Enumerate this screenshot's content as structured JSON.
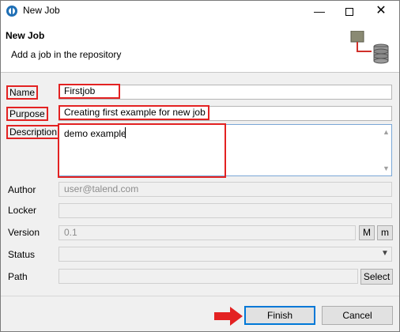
{
  "window": {
    "title": "New Job"
  },
  "header": {
    "title": "New Job",
    "subtitle": "Add a job in the repository"
  },
  "form": {
    "name": {
      "label": "Name",
      "value": "Firstjob"
    },
    "purpose": {
      "label": "Purpose",
      "value": "Creating first example for new job"
    },
    "description": {
      "label": "Description",
      "value": "demo example"
    },
    "author": {
      "label": "Author",
      "value": "user@talend.com"
    },
    "locker": {
      "label": "Locker",
      "value": ""
    },
    "version": {
      "label": "Version",
      "value": "0.1",
      "major_button": "M",
      "minor_button": "m"
    },
    "status": {
      "label": "Status",
      "value": ""
    },
    "path": {
      "label": "Path",
      "value": "",
      "select_button": "Select"
    }
  },
  "buttons": {
    "finish": "Finish",
    "cancel": "Cancel"
  },
  "colors": {
    "highlight": "#e32222",
    "accent": "#0078d7",
    "title_icon": "#1f6fb5"
  },
  "icons": {
    "app": "talend-app-icon",
    "minimize": "minimize-icon",
    "maximize": "maximize-icon",
    "close": "close-icon",
    "header": "job-repository-icon",
    "arrow": "red-arrow-icon"
  }
}
